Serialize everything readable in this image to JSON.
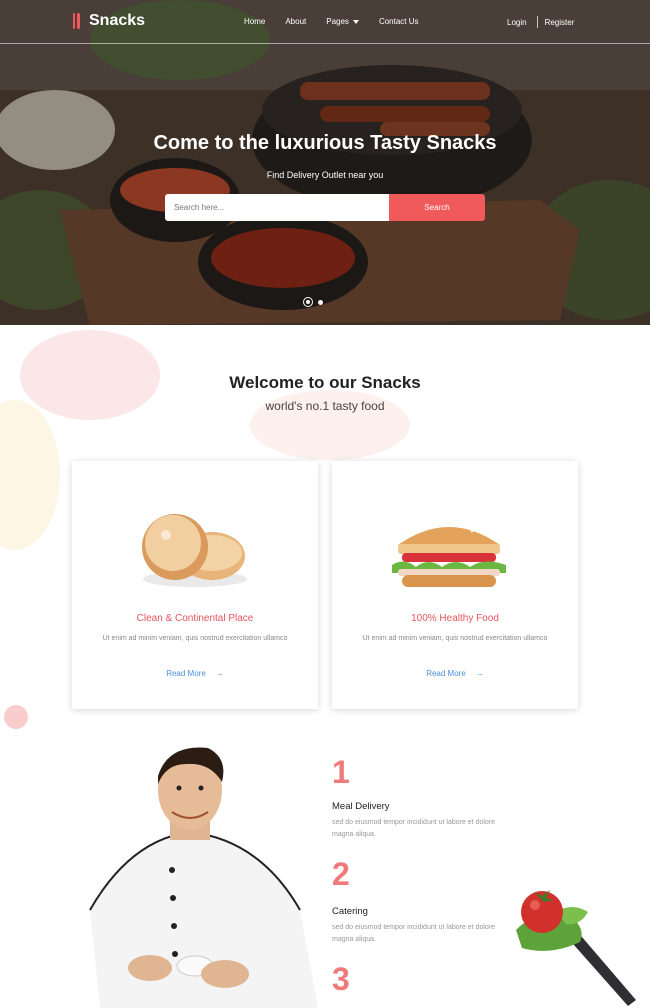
{
  "brand": {
    "logo_text": "Snacks",
    "accent": "#f05a5a"
  },
  "nav": {
    "links": [
      "Home",
      "About",
      "Pages",
      "Contact Us"
    ],
    "login": "Login",
    "register": "Register"
  },
  "hero": {
    "title_prefix": "Come to the luxurious",
    "title_bold": "Tasty Snacks",
    "subtitle": "Find Delivery Outlet near you",
    "search_placeholder": "Search here...",
    "search_button": "Search"
  },
  "welcome": {
    "title": "Welcome to our Snacks",
    "subtitle": "world's no.1 tasty food"
  },
  "cards": [
    {
      "title": "Clean & Continental Place",
      "text": "Ut enim ad minim veniam, quis nostrud exercitation ullamco",
      "link": "Read More"
    },
    {
      "title": "100% Healthy Food",
      "text": "Ut enim ad minim veniam, quis nostrud exercitation ullamco",
      "link": "Read More"
    }
  ],
  "features": [
    {
      "num": "1",
      "title": "Meal Delivery",
      "text": "sed do eiusmod tempor incididunt ut labore et dolore magna aliqua."
    },
    {
      "num": "2",
      "title": "Catering",
      "text": "sed do eiusmod tempor incididunt ut labore et dolore magna aliqua."
    },
    {
      "num": "3"
    }
  ]
}
